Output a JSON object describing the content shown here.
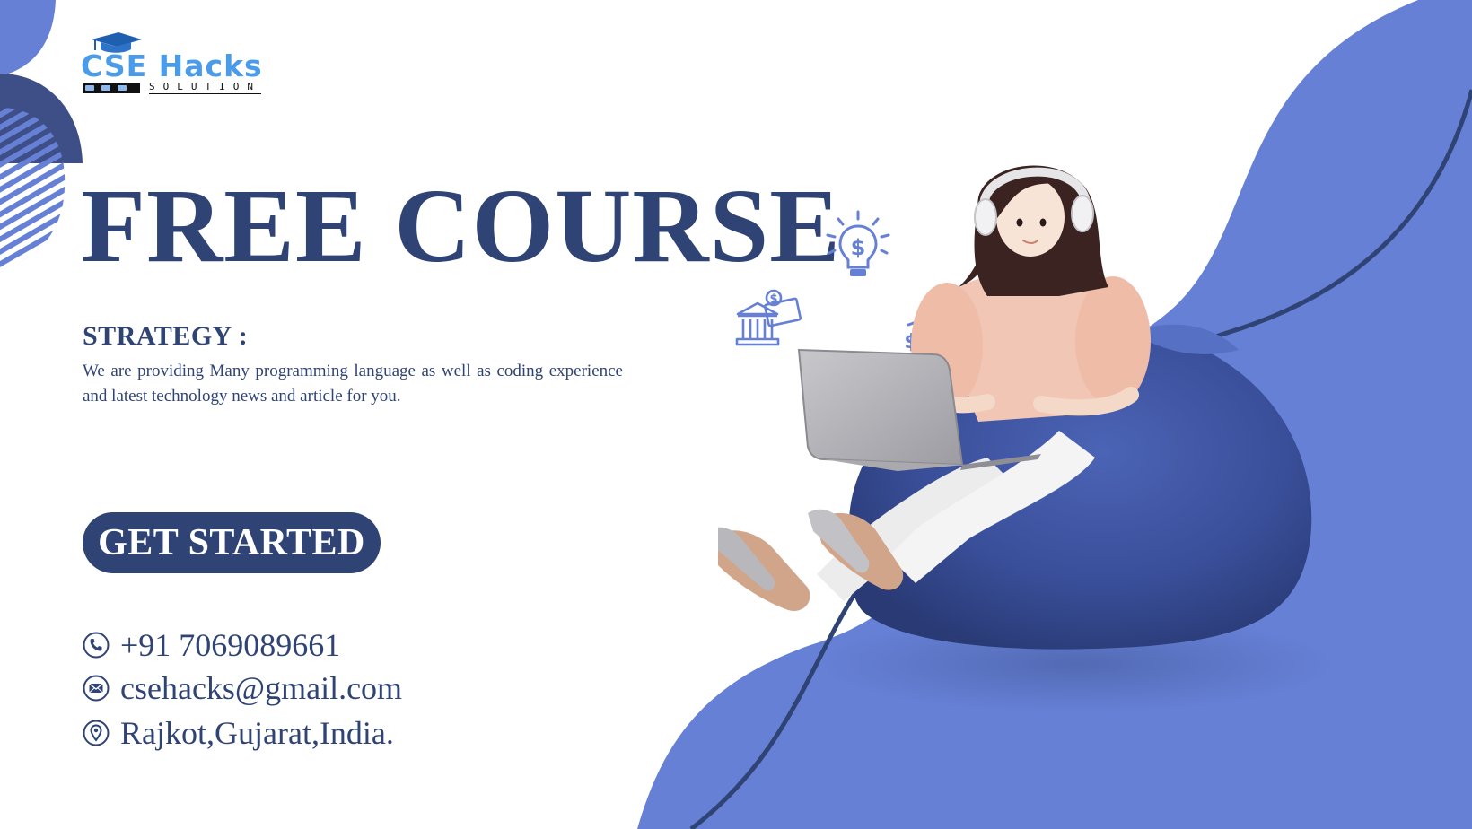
{
  "brand": {
    "name": "CSE Hacks",
    "tagline": "SOLUTION",
    "logo_color": "#4a9bea"
  },
  "hero": {
    "headline": "FREE COURSE",
    "strategy_title": "STRATEGY :",
    "strategy_text": "We are providing Many programming language as well as coding experience and latest technology news and article for you.",
    "cta_label": "GET STARTED"
  },
  "contact": {
    "phone": "+91 7069089661",
    "email": "csehacks@gmail.com",
    "location": "Rajkot,Gujarat,India."
  },
  "icons": {
    "phone": "phone-icon",
    "email": "email-icon",
    "location": "location-pin-icon",
    "idea": "lightbulb-dollar-icon",
    "bank": "bank-money-icon",
    "growth": "growth-chart-icon"
  },
  "colors": {
    "primary": "#2f4375",
    "accent": "#6680d6",
    "background": "#ffffff"
  }
}
